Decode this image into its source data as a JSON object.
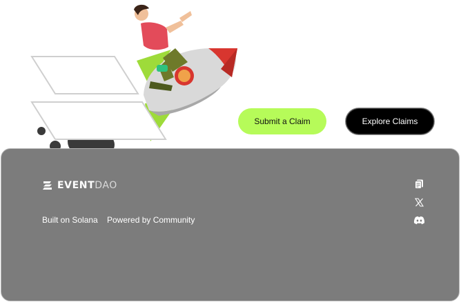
{
  "hero": {
    "illustration": "person-riding-rocket-illustration"
  },
  "cta": {
    "submit_label": "Submit a Claim",
    "explore_label": "Explore Claims",
    "submit_color": "#b6fb59",
    "explore_color": "#000000"
  },
  "footer": {
    "background": "#7c7c7c",
    "brand": {
      "strong": "EVENT",
      "light": "DAO",
      "logo_icon": "event-dao-logo-icon"
    },
    "links": [
      {
        "label": "Built on Solana"
      },
      {
        "label": "Powered by Community"
      }
    ],
    "social": [
      {
        "icon": "docs-icon"
      },
      {
        "icon": "x-icon"
      },
      {
        "icon": "discord-icon"
      }
    ]
  }
}
